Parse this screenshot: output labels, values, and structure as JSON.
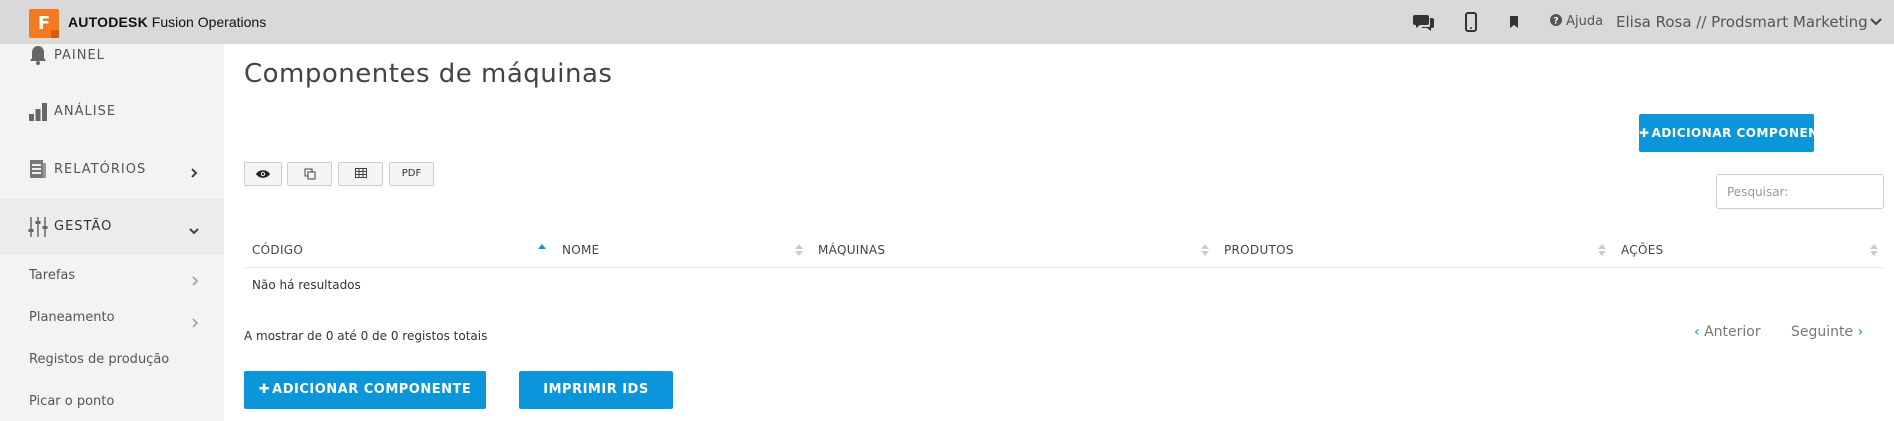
{
  "app": {
    "logo_letter": "F",
    "brand_bold": "AUTODESK",
    "brand_rest": " Fusion Operations",
    "accent_color": "#0b96d9",
    "logo_color": "#f27b21"
  },
  "topbar": {
    "icons": [
      "chat-icon",
      "mobile-icon",
      "bookmark-icon",
      "help-icon",
      "chevron-down-icon"
    ],
    "help_label": "Ajuda",
    "user_label": "Elisa Rosa // Prodsmart Marketing"
  },
  "sidebar": {
    "items": [
      {
        "label": "PAINEL",
        "icon": "bell-icon"
      },
      {
        "label": "ANÁLISE",
        "icon": "bar-chart-icon"
      },
      {
        "label": "RELATÓRIOS",
        "icon": "report-icon"
      },
      {
        "label": "GESTÃO",
        "icon": "sliders-icon"
      }
    ],
    "sub_items": [
      {
        "label": "Tarefas"
      },
      {
        "label": "Planeamento"
      },
      {
        "label": "Registos de produção"
      },
      {
        "label": "Picar o ponto"
      }
    ]
  },
  "main": {
    "title": "Componentes de máquinas",
    "add_button_label": "ADICIONAR COMPONENTE",
    "toolbar": {
      "buttons": [
        "eye-icon",
        "copy-icon",
        "table-icon"
      ],
      "pdf_label": "PDF"
    },
    "search": {
      "placeholder": "Pesquisar:",
      "value": ""
    },
    "table": {
      "columns": [
        "CÓDIGO",
        "NOME",
        "MÁQUINAS",
        "PRODUTOS",
        "AÇÕES"
      ],
      "sorted_column": "CÓDIGO",
      "sort_direction": "ascending",
      "empty_text": "Não há resultados",
      "info_text": "A mostrar de 0 até 0 de 0 registos totais"
    },
    "pagination": {
      "prev_label": "Anterior",
      "next_label": "Seguinte"
    },
    "bottom_buttons": {
      "add_label": "ADICIONAR COMPONENTE",
      "print_label": "IMPRIMIR IDS"
    }
  }
}
